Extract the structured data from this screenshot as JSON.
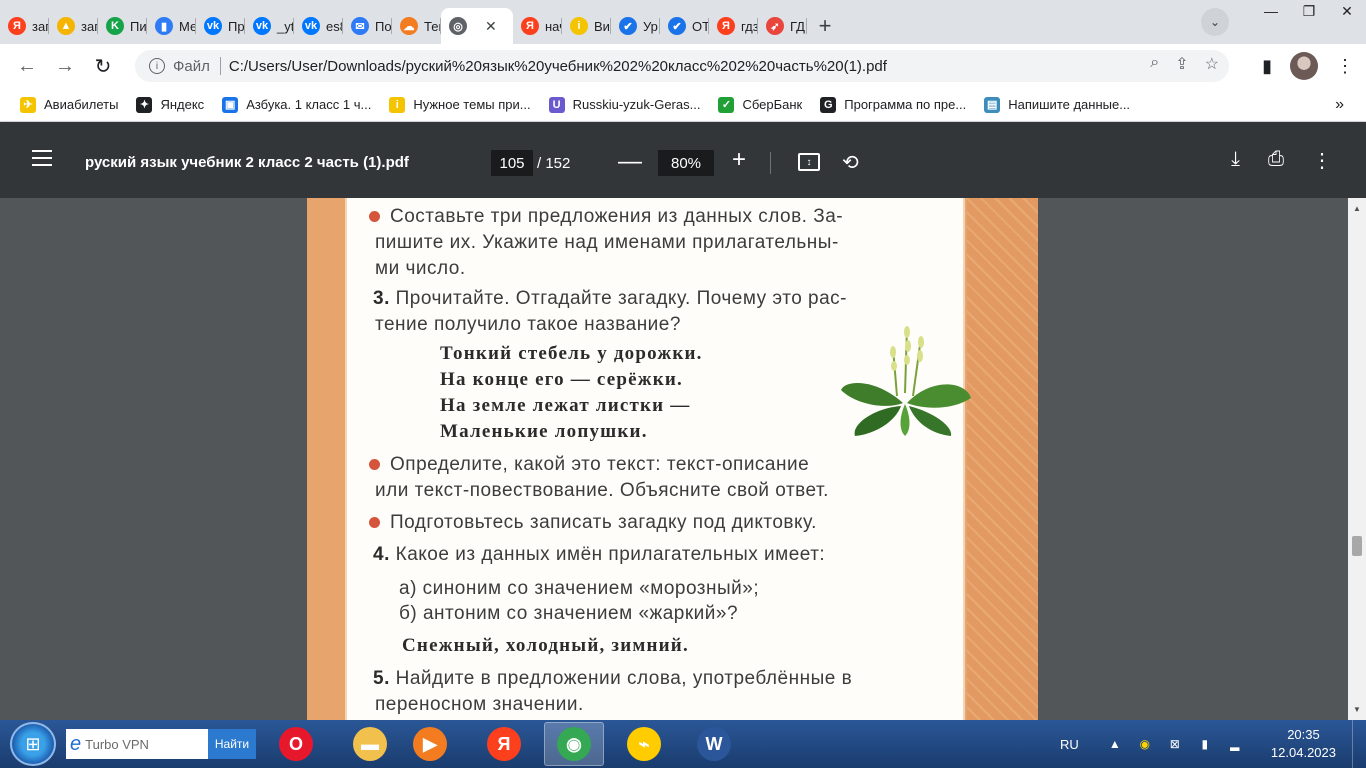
{
  "browser": {
    "tabs": [
      {
        "label": "зап",
        "icon": "yandex-icon",
        "color": "#fc3f1d",
        "glyph": "Я"
      },
      {
        "label": "зап",
        "icon": "gallery-icon",
        "color": "#f5b400",
        "glyph": "▲"
      },
      {
        "label": "Пи",
        "icon": "kinopoisk-icon",
        "color": "#17a34a",
        "glyph": "K"
      },
      {
        "label": "Ме",
        "icon": "messenger-icon",
        "color": "#2f7bf5",
        "glyph": "▮"
      },
      {
        "label": "Пр",
        "icon": "vk-icon",
        "color": "#0077ff",
        "glyph": "vk"
      },
      {
        "label": "_yt",
        "icon": "vk-icon",
        "color": "#0077ff",
        "glyph": "vk"
      },
      {
        "label": "es8",
        "icon": "vk-icon",
        "color": "#0077ff",
        "glyph": "vk"
      },
      {
        "label": "По",
        "icon": "mail-icon",
        "color": "#2f7bf5",
        "glyph": "✉"
      },
      {
        "label": "Тег",
        "icon": "cloud-icon",
        "color": "#f47c20",
        "glyph": "☁"
      },
      {
        "label": "",
        "icon": "globe-icon",
        "color": "#5f6368",
        "glyph": "◎",
        "active": true
      },
      {
        "label": "нач",
        "icon": "yandex-icon",
        "color": "#fc3f1d",
        "glyph": "Я"
      },
      {
        "label": "Ви",
        "icon": "info-icon",
        "color": "#f5c400",
        "glyph": "i"
      },
      {
        "label": "Ур",
        "icon": "check-icon",
        "color": "#1a73e8",
        "glyph": "✔"
      },
      {
        "label": "ОТ",
        "icon": "check-icon",
        "color": "#1a73e8",
        "glyph": "✔"
      },
      {
        "label": "гдз",
        "icon": "yandex-icon",
        "color": "#fc3f1d",
        "glyph": "Я"
      },
      {
        "label": "ГД",
        "icon": "rocket-icon",
        "color": "#e8453c",
        "glyph": "➶"
      }
    ],
    "active_tab_close": "✕",
    "new_tab": "+",
    "address": {
      "scheme_label": "Файл",
      "url": "C:/Users/User/Downloads/руский%20язык%20учебник%202%20класс%202%20часть%20(1).pdf"
    },
    "bookmarks": [
      {
        "label": "Авиабилеты",
        "icon": "plane-icon",
        "color": "#f5c400",
        "glyph": "✈"
      },
      {
        "label": "Яндекс",
        "icon": "yandex-star-icon",
        "color": "#202124",
        "glyph": "✦"
      },
      {
        "label": "Азбука. 1 класс 1 ч...",
        "icon": "book-icon",
        "color": "#1a73e8",
        "glyph": "▣"
      },
      {
        "label": "Нужное темы при...",
        "icon": "info-icon",
        "color": "#f5c400",
        "glyph": "i"
      },
      {
        "label": "Russkiu-yzuk-Geras...",
        "icon": "shield-icon",
        "color": "#6a5acd",
        "glyph": "U"
      },
      {
        "label": "СберБанк",
        "icon": "sber-icon",
        "color": "#21a038",
        "glyph": "✓"
      },
      {
        "label": "Программа по пре...",
        "icon": "g-icon",
        "color": "#202124",
        "glyph": "G"
      },
      {
        "label": "Напишите данные...",
        "icon": "db-icon",
        "color": "#3c8dbc",
        "glyph": "▤"
      }
    ],
    "bookmarks_more": "»"
  },
  "pdf_toolbar": {
    "title": "руский язык учебник 2 класс 2 часть (1).pdf",
    "page_current": "105",
    "page_total": "/ 152",
    "zoom": "80%",
    "zoom_out": "—",
    "zoom_in": "+"
  },
  "pdf_page": {
    "line1": "Составьте три предложения из данных слов. За-",
    "line2": "пишите их. Укажите над именами прилагательны-",
    "line3": "ми число.",
    "ex3_num": "3.",
    "ex3_line1": "Прочитайте. Отгадайте загадку. Почему это рас-",
    "ex3_line2": "тение получило такое название?",
    "poem": [
      "Тонкий стебель у дорожки.",
      "На конце его — серёжки.",
      "На земле лежат листки —",
      "Маленькие лопушки."
    ],
    "task_a_line1": "Определите, какой это текст: текст-описание",
    "task_a_line2": "или текст-повествование. Объясните свой ответ.",
    "task_b": "Подготовьтесь записать загадку под диктовку.",
    "ex4_num": "4.",
    "ex4_text": "Какое из данных имён прилагательных имеет:",
    "ex4_a": "а) синоним со значением «морозный»;",
    "ex4_b": "б) антоним со значением «жаркий»?",
    "ex4_words": "Снежный, холодный, зимний.",
    "ex5_num": "5.",
    "ex5_line1": "Найдите в предложении слова, употреблённые в",
    "ex5_line2": "переносном значении."
  },
  "taskbar": {
    "search_text": "Turbo VPN",
    "search_button": "Найти",
    "apps": [
      {
        "name": "opera-icon",
        "color": "#e8182c",
        "glyph": "O"
      },
      {
        "name": "explorer-icon",
        "color": "#f2c04d",
        "glyph": "▬"
      },
      {
        "name": "media-player-icon",
        "color": "#f47c20",
        "glyph": "▶"
      },
      {
        "name": "yandex-browser-icon",
        "color": "#fc3f1d",
        "glyph": "Я"
      },
      {
        "name": "chrome-icon",
        "color": "#34a853",
        "glyph": "◉",
        "active": true
      },
      {
        "name": "yandex-market-icon",
        "color": "#ffcc00",
        "glyph": "⌁"
      },
      {
        "name": "word-icon",
        "color": "#2b579a",
        "glyph": "W"
      }
    ],
    "lang": "RU",
    "time": "20:35",
    "date": "12.04.2023"
  }
}
